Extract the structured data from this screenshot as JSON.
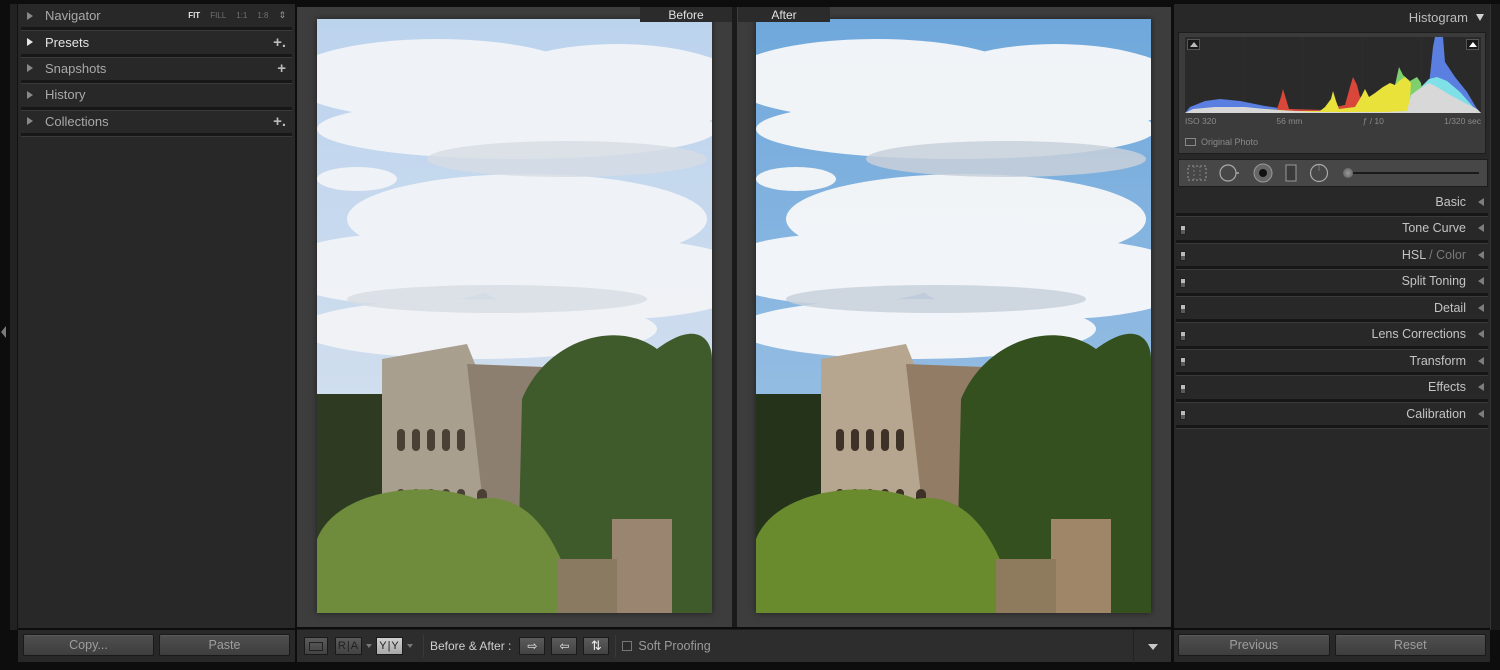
{
  "left_panel": {
    "sections": [
      {
        "label": "Navigator",
        "open": false,
        "active": false,
        "action": ""
      },
      {
        "label": "Presets",
        "open": true,
        "active": true,
        "action": "+."
      },
      {
        "label": "Snapshots",
        "open": false,
        "active": false,
        "action": "+"
      },
      {
        "label": "History",
        "open": false,
        "active": false,
        "action": ""
      },
      {
        "label": "Collections",
        "open": false,
        "active": false,
        "action": "+."
      }
    ],
    "navigator_zoom": {
      "options": [
        "FIT",
        "FILL",
        "1:1",
        "1:8"
      ],
      "selected": "FIT",
      "stepper_glyph": "⇕"
    },
    "footer": {
      "copy_label": "Copy...",
      "paste_label": "Paste"
    }
  },
  "center": {
    "before_label": "Before",
    "after_label": "After",
    "photo_subject": "Colosseum, Rome",
    "before_sky_color": "#c9daef",
    "after_sky_color": "#7fb3de"
  },
  "toolbar": {
    "loupe_icon": "loupe-view-icon",
    "ra_label": "R|A",
    "yy_label": "Y|Y",
    "before_after_label": "Before & After :",
    "copy_before_to_after_glyph": "⇨",
    "copy_after_to_before_glyph": "⇦",
    "swap_glyph": "⇅",
    "soft_proofing_label": "Soft Proofing",
    "soft_proofing_checked": false
  },
  "right_panel": {
    "histogram": {
      "title": "Histogram",
      "iso": "ISO 320",
      "focal_length": "56 mm",
      "aperture": "ƒ / 10",
      "shutter": "1/320 sec",
      "original_photo_label": "Original Photo",
      "colors": {
        "blue": "#5b7fe0",
        "red": "#d8473a",
        "yellow": "#e8e23a",
        "green": "#7ecf6e",
        "cyan": "#7fe0e8",
        "luma": "#d8d8d8"
      }
    },
    "tools": [
      "crop-overlay",
      "spot-removal",
      "red-eye-correction",
      "graduated-filter",
      "radial-filter",
      "adjustment-brush"
    ],
    "sections": [
      {
        "label": "Basic",
        "dim": "",
        "switch": false
      },
      {
        "label": "Tone Curve",
        "dim": "",
        "switch": true
      },
      {
        "label": "HSL",
        "dim": " / Color",
        "switch": true
      },
      {
        "label": "Split Toning",
        "dim": "",
        "switch": true
      },
      {
        "label": "Detail",
        "dim": "",
        "switch": true
      },
      {
        "label": "Lens Corrections",
        "dim": "",
        "switch": true
      },
      {
        "label": "Transform",
        "dim": "",
        "switch": true
      },
      {
        "label": "Effects",
        "dim": "",
        "switch": true
      },
      {
        "label": "Calibration",
        "dim": "",
        "switch": true
      }
    ],
    "footer": {
      "previous_label": "Previous",
      "reset_label": "Reset"
    }
  }
}
